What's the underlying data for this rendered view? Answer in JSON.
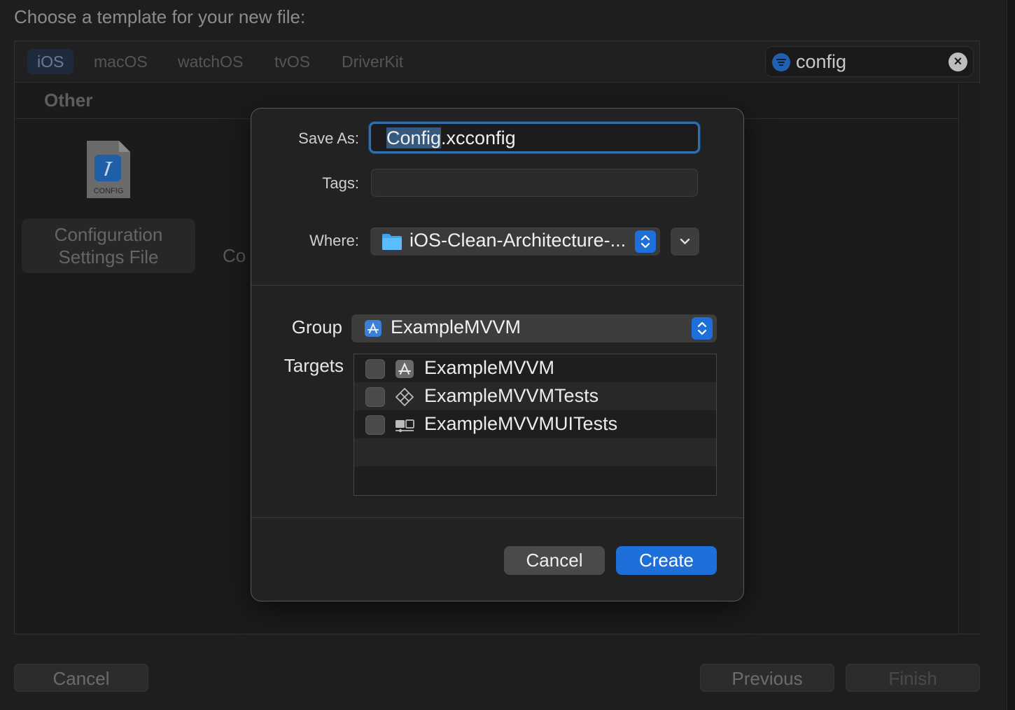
{
  "window": {
    "header_title": "Choose a template for your new file:"
  },
  "platform_tabs": [
    {
      "label": "iOS",
      "active": true
    },
    {
      "label": "macOS",
      "active": false
    },
    {
      "label": "watchOS",
      "active": false
    },
    {
      "label": "tvOS",
      "active": false
    },
    {
      "label": "DriverKit",
      "active": false
    }
  ],
  "search": {
    "value": "config"
  },
  "section": {
    "title": "Other"
  },
  "templates": [
    {
      "label_line1": "Configuration",
      "label_line2": "Settings File",
      "icon_text": "CONFIG",
      "selected": true
    },
    {
      "label_partial": "Co"
    }
  ],
  "bottom_buttons": {
    "cancel": "Cancel",
    "previous": "Previous",
    "finish": "Finish"
  },
  "sheet": {
    "save_as_label": "Save As:",
    "save_as_selected": "Config",
    "save_as_rest": ".xcconfig",
    "tags_label": "Tags:",
    "tags_value": "",
    "where_label": "Where:",
    "where_value": "iOS-Clean-Architecture-...",
    "group_label": "Group",
    "group_value": "ExampleMVVM",
    "targets_label": "Targets",
    "targets": [
      {
        "name": "ExampleMVVM",
        "icon": "app-target-icon",
        "checked": false
      },
      {
        "name": "ExampleMVVMTests",
        "icon": "unit-test-target-icon",
        "checked": false
      },
      {
        "name": "ExampleMVVMUITests",
        "icon": "ui-test-target-icon",
        "checked": false
      }
    ],
    "cancel_label": "Cancel",
    "create_label": "Create"
  },
  "colors": {
    "accent": "#1e6fd9",
    "background": "#1e1e1e",
    "sheet": "#222222"
  }
}
